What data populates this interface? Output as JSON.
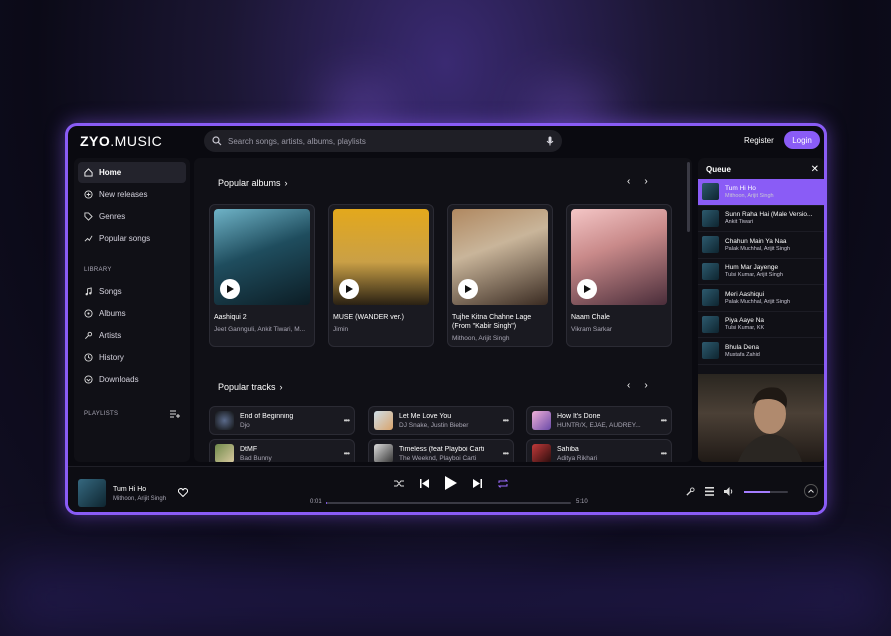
{
  "app": {
    "logo_bold": "ZYO",
    "logo_rest": ".MUSIC",
    "search_placeholder": "Search songs, artists, albums, playlists",
    "register_label": "Register",
    "login_label": "Login"
  },
  "sidebar": {
    "items": [
      {
        "label": "Home",
        "icon": "home-icon"
      },
      {
        "label": "New releases",
        "icon": "plus-circle-icon"
      },
      {
        "label": "Genres",
        "icon": "tag-icon"
      },
      {
        "label": "Popular songs",
        "icon": "trend-icon"
      }
    ],
    "library_label": "LIBRARY",
    "library_items": [
      {
        "label": "Songs",
        "icon": "note-icon"
      },
      {
        "label": "Albums",
        "icon": "disc-icon"
      },
      {
        "label": "Artists",
        "icon": "mic-icon"
      },
      {
        "label": "History",
        "icon": "history-icon"
      },
      {
        "label": "Downloads",
        "icon": "download-icon"
      }
    ],
    "playlists_label": "PLAYLISTS"
  },
  "main": {
    "albums_title": "Popular albums",
    "albums": [
      {
        "title": "Aashiqui 2",
        "artist": "Jeet Gannguli, Ankit Tiwari, M..."
      },
      {
        "title": "MUSE (WANDER ver.)",
        "artist": "Jimin"
      },
      {
        "title": "Tujhe Kitna Chahne Lage (From \"Kabir Singh\")",
        "artist": "Mithoon, Arijit Singh"
      },
      {
        "title": "Naam Chale",
        "artist": "Vikram Sarkar"
      }
    ],
    "tracks_title": "Popular tracks",
    "tracks": [
      {
        "title": "End of Beginning",
        "artist": "Djo"
      },
      {
        "title": "Let Me Love You",
        "artist": "DJ Snake, Justin Bieber"
      },
      {
        "title": "How It's Done",
        "artist": "HUNTR/X, EJAE, AUDREY..."
      },
      {
        "title": "DtMF",
        "artist": "Bad Bunny"
      },
      {
        "title": "Timeless (feat Playboi Carti",
        "artist": "The Weeknd, Playboi Carti"
      },
      {
        "title": "Sahiba",
        "artist": "Aditya Rikhari"
      }
    ]
  },
  "queue": {
    "title": "Queue",
    "items": [
      {
        "title": "Tum Hi Ho",
        "artist": "Mithoon, Arijit Singh"
      },
      {
        "title": "Sunn Raha Hai (Male Versio...",
        "artist": "Ankit Tiwari"
      },
      {
        "title": "Chahun Main Ya Naa",
        "artist": "Palak Muchhal, Arijit Singh"
      },
      {
        "title": "Hum Mar Jayenge",
        "artist": "Tulsi Kumar, Arijit Singh"
      },
      {
        "title": "Meri Aashiqui",
        "artist": "Palak Muchhal, Arijit Singh"
      },
      {
        "title": "Piya Aaye Na",
        "artist": "Tulsi Kumar, KK"
      },
      {
        "title": "Bhula Dena",
        "artist": "Mustafa Zahid"
      }
    ]
  },
  "player": {
    "title": "Tum Hi Ho",
    "artist": "Mithoon, Arijit Singh",
    "current_time": "0:01",
    "duration": "5:10",
    "progress_fraction": 0.004,
    "volume_fraction": 0.6
  },
  "colors": {
    "accent": "#8a5cf6"
  }
}
